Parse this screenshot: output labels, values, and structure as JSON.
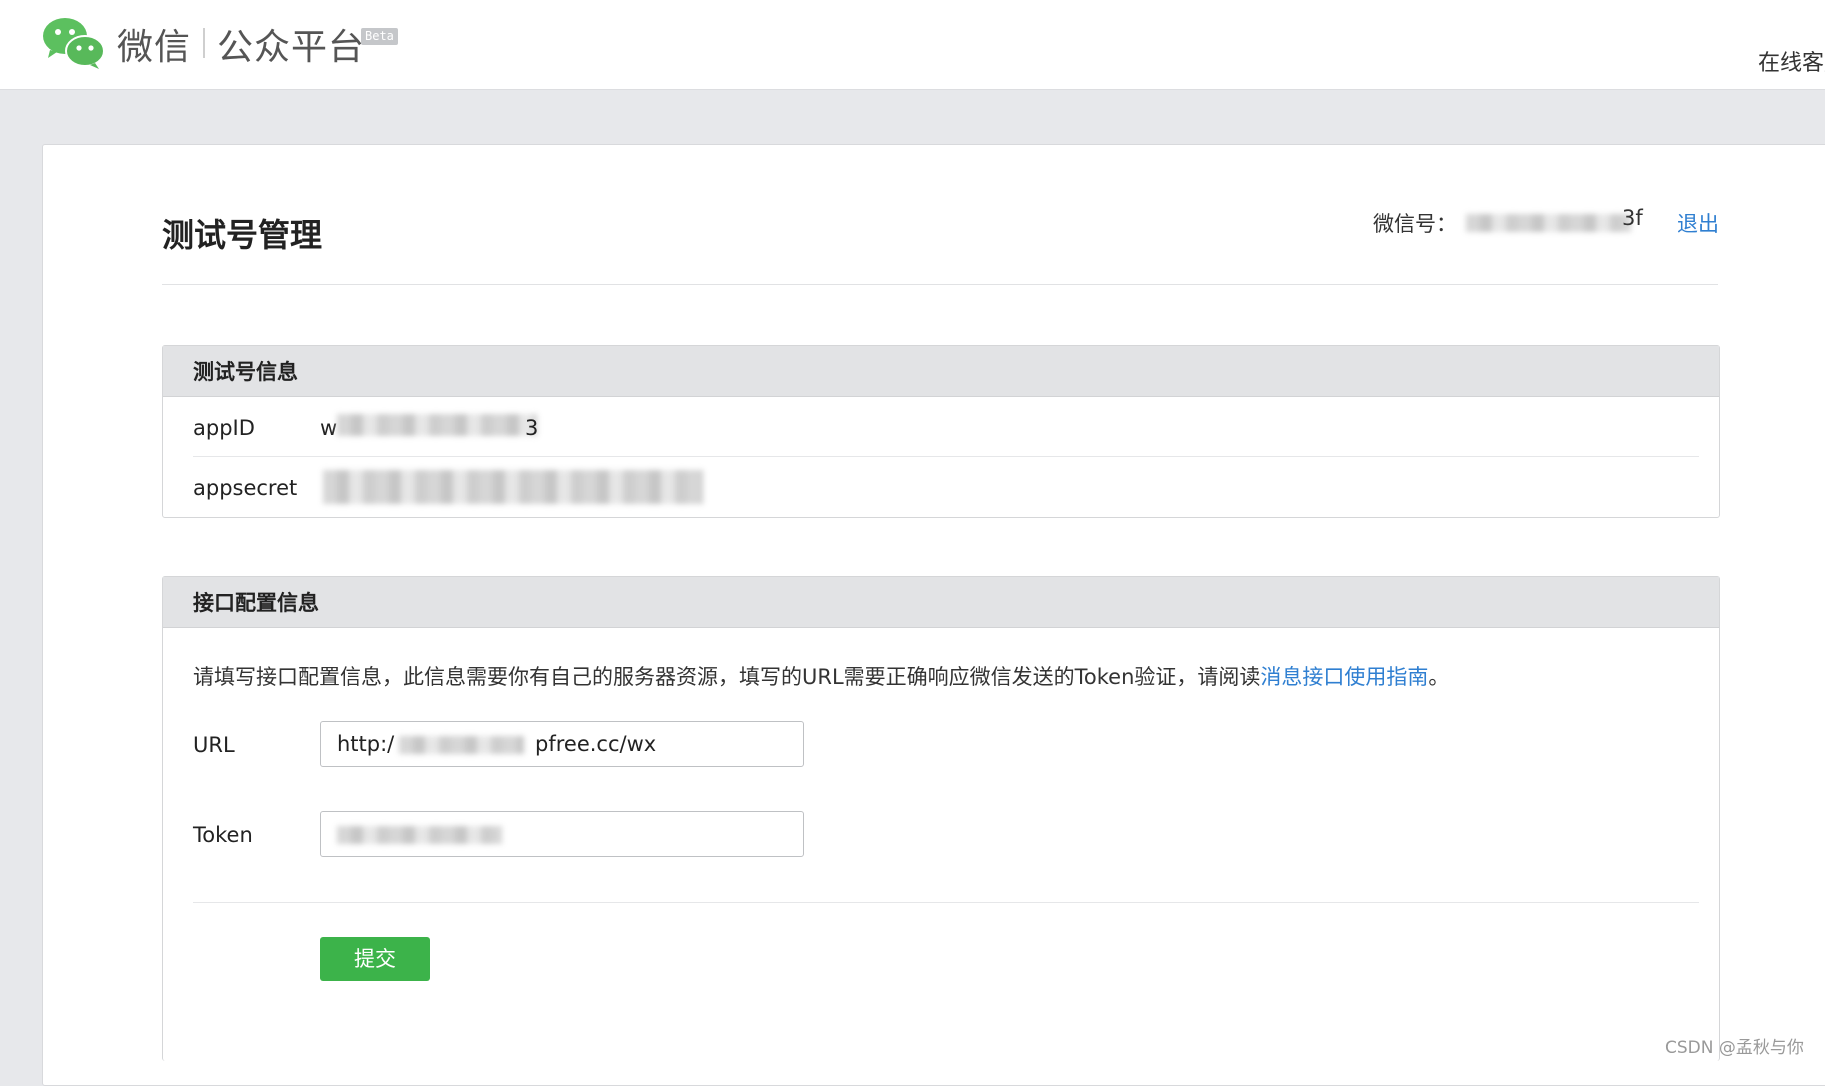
{
  "header": {
    "brand_weixin": "微信",
    "brand_platform": "公众平台",
    "beta_badge": "Beta",
    "online_service": "在线客服"
  },
  "page": {
    "title": "测试号管理",
    "wx_label": "微信号：",
    "wx_value_visible_suffix": "3f",
    "logout": "退出"
  },
  "test_account_panel": {
    "title": "测试号信息",
    "rows": [
      {
        "label": "appID",
        "value_prefix": "w",
        "value_suffix": "3"
      },
      {
        "label": "appsecret"
      }
    ]
  },
  "interface_panel": {
    "title": "接口配置信息",
    "description": "请填写接口配置信息，此信息需要你有自己的服务器资源，填写的URL需要正确响应微信发送的Token验证，请阅读",
    "guide_link": "消息接口使用指南",
    "description_end": "。",
    "url_label": "URL",
    "url_prefix": "http:/",
    "url_suffix": "pfree.cc/wx",
    "token_label": "Token",
    "submit_label": "提交"
  },
  "watermark": "CSDN @孟秋与你",
  "colors": {
    "accent_link": "#2f7fd1",
    "submit_green": "#3cb34a",
    "panel_header": "#e2e3e5"
  }
}
